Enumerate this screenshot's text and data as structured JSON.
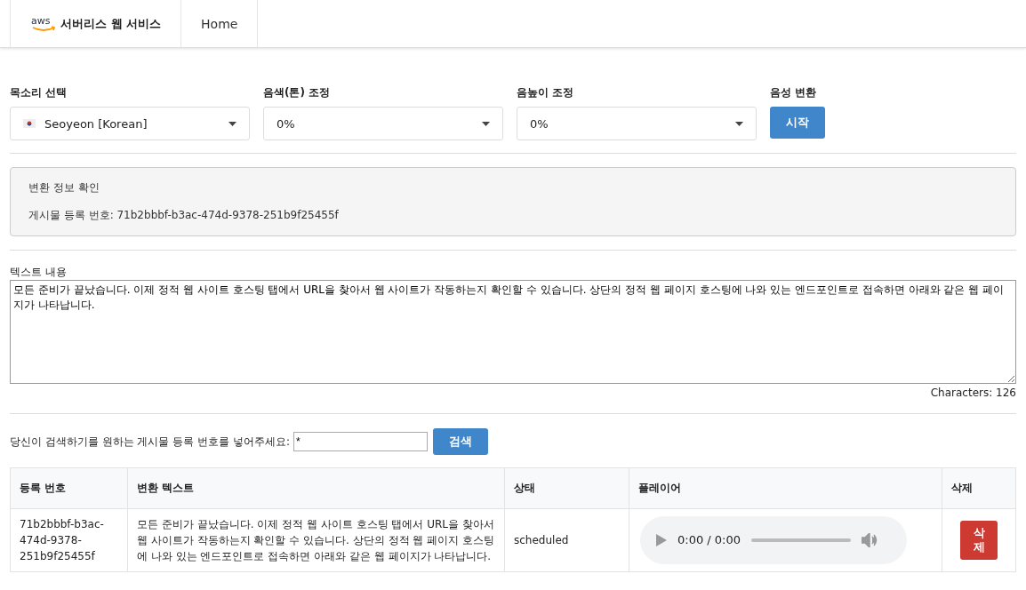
{
  "navbar": {
    "logo": "aws",
    "brand": "서버리스 웹 서비스",
    "links": [
      "Home"
    ]
  },
  "controls": [
    {
      "kind": "select",
      "label": "목소리 선택",
      "value": "Seoyeon [Korean]",
      "flag": true
    },
    {
      "kind": "select",
      "label": "음색(톤) 조정",
      "value": "0%"
    },
    {
      "kind": "select",
      "label": "음높이 조정",
      "value": "0%"
    },
    {
      "kind": "button",
      "label": "음성 변환",
      "value": "시작"
    }
  ],
  "info": {
    "title": "변환 정보 확인",
    "text": "게시물 등록 번호: 71b2bbbf-b3ac-474d-9378-251b9f25455f"
  },
  "text_content": {
    "label": "텍스트 내용",
    "value": "모든 준비가 끝났습니다. 이제 정적 웹 사이트 호스팅 탭에서 URL을 찾아서 웹 사이트가 작동하는지 확인할 수 있습니다. 상단의 정적 웹 페이지 호스팅에 나와 있는 엔드포인트로 접속하면 아래와 같은 웹 페이지가 나타납니다.",
    "counter": "Characters: 126"
  },
  "search": {
    "label": "당신이 검색하기를 원하는 게시물 등록 번호를 넣어주세요:",
    "value": "*",
    "button": "검색"
  },
  "table": {
    "columns": [
      "등록 번호",
      "변환 텍스트",
      "상태",
      "플레이어",
      "삭제"
    ],
    "rows": [
      {
        "id": "71b2bbbf-b3ac-474d-9378-251b9f25455f",
        "text": "모든 준비가 끝났습니다. 이제 정적 웹 사이트 호스팅 탭에서 URL을 찾아서 웹 사이트가 작동하는지 확인할 수 있습니다. 상단의 정적 웹 페이지 호스팅에 나와 있는 엔드포인트로 접속하면 아래와 같은 웹 페이지가 나타납니다.",
        "status": "scheduled",
        "time": "0:00 / 0:00",
        "delete": "삭제"
      }
    ]
  }
}
